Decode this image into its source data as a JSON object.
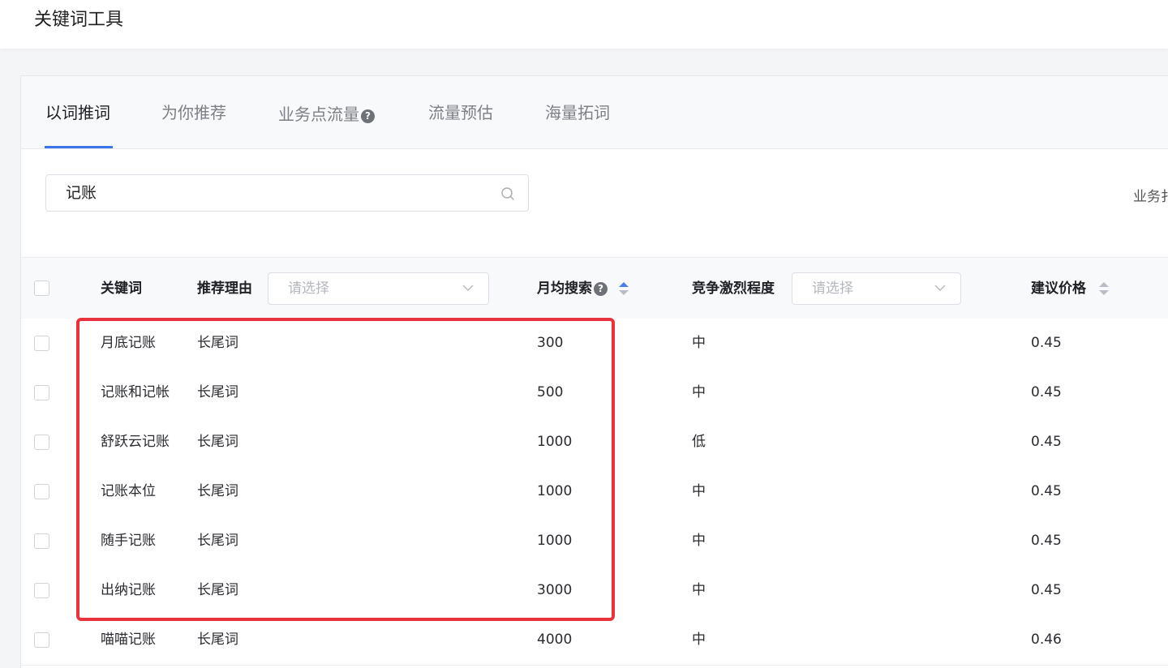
{
  "header": {
    "title": "关键词工具"
  },
  "tabs": [
    {
      "label": "以词推词",
      "active": true
    },
    {
      "label": "为你推荐"
    },
    {
      "label": "业务点流量",
      "has_help_icon": true
    },
    {
      "label": "流量预估"
    },
    {
      "label": "海量拓词"
    }
  ],
  "help_glyph": "?",
  "search": {
    "value": "记账",
    "icon": "search-icon"
  },
  "biz_label": "业务扌",
  "table": {
    "headers": {
      "keyword": "关键词",
      "reason": "推荐理由",
      "reason_filter_placeholder": "请选择",
      "monthly_search": "月均搜索",
      "competition": "竞争激烈程度",
      "competition_filter_placeholder": "请选择",
      "price": "建议价格"
    },
    "rows": [
      {
        "keyword": "月底记账",
        "reason": "长尾词",
        "monthly_search": "300",
        "competition": "中",
        "price": "0.45"
      },
      {
        "keyword": "记账和记帐",
        "reason": "长尾词",
        "monthly_search": "500",
        "competition": "中",
        "price": "0.45"
      },
      {
        "keyword": "舒跃云记账",
        "reason": "长尾词",
        "monthly_search": "1000",
        "competition": "低",
        "price": "0.45"
      },
      {
        "keyword": "记账本位",
        "reason": "长尾词",
        "monthly_search": "1000",
        "competition": "中",
        "price": "0.45"
      },
      {
        "keyword": "随手记账",
        "reason": "长尾词",
        "monthly_search": "1000",
        "competition": "中",
        "price": "0.45"
      },
      {
        "keyword": "出纳记账",
        "reason": "长尾词",
        "monthly_search": "3000",
        "competition": "中",
        "price": "0.45"
      },
      {
        "keyword": "喵喵记账",
        "reason": "长尾词",
        "monthly_search": "4000",
        "competition": "中",
        "price": "0.46"
      }
    ]
  },
  "colors": {
    "accent": "#3b73e8",
    "highlight": "#e8323c",
    "sort_active": "#4a7ee8",
    "sort_inactive": "#b8bcc4"
  }
}
